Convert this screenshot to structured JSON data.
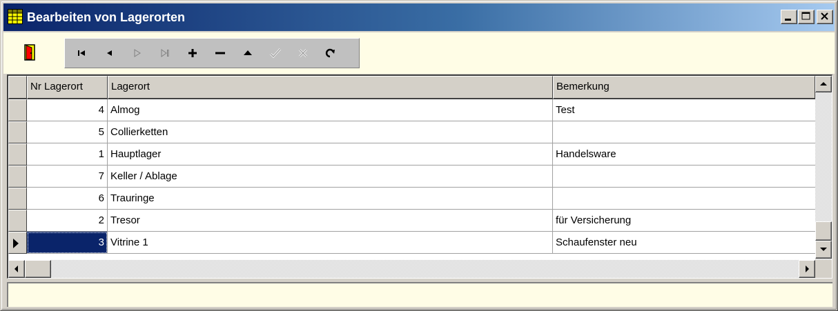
{
  "window": {
    "title": "Bearbeiten von Lagerorten",
    "title_icon": "table-grid-icon"
  },
  "toolbar": {
    "exit_icon": "exit-door-icon",
    "navigator": [
      {
        "name": "first-record-icon",
        "enabled": true
      },
      {
        "name": "prior-record-icon",
        "enabled": true
      },
      {
        "name": "next-record-icon",
        "enabled": false
      },
      {
        "name": "last-record-icon",
        "enabled": false
      },
      {
        "name": "insert-record-icon",
        "enabled": true
      },
      {
        "name": "delete-record-icon",
        "enabled": true
      },
      {
        "name": "edit-record-icon",
        "enabled": true
      },
      {
        "name": "post-record-icon",
        "enabled": false
      },
      {
        "name": "cancel-record-icon",
        "enabled": false
      },
      {
        "name": "refresh-icon",
        "enabled": true
      }
    ]
  },
  "grid": {
    "columns": [
      "Nr Lagerort",
      "Lagerort",
      "Bemerkung"
    ],
    "rows": [
      {
        "nr": "4",
        "lagerort": "Almog",
        "bemerkung": "Test"
      },
      {
        "nr": "5",
        "lagerort": "Collierketten",
        "bemerkung": ""
      },
      {
        "nr": "1",
        "lagerort": "Hauptlager",
        "bemerkung": "Handelsware"
      },
      {
        "nr": "7",
        "lagerort": "Keller / Ablage",
        "bemerkung": ""
      },
      {
        "nr": "6",
        "lagerort": "Trauringe",
        "bemerkung": ""
      },
      {
        "nr": "2",
        "lagerort": "Tresor",
        "bemerkung": "für Versicherung"
      },
      {
        "nr": "3",
        "lagerort": "Vitrine 1",
        "bemerkung": "Schaufenster neu"
      }
    ],
    "selected_row": 6
  },
  "colors": {
    "title_start": "#0a246a",
    "title_end": "#a6caf0",
    "panel_bg": "#fffde6",
    "selection": "#0a246a"
  }
}
